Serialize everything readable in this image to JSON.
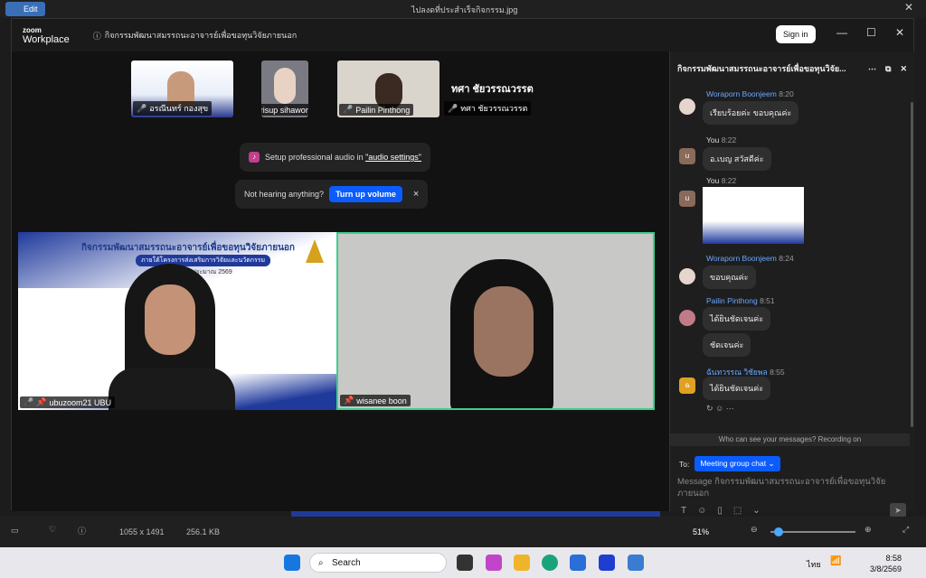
{
  "photos": {
    "edit": "Edit",
    "filename": "ไปลงดที่ประสำเร็จกิจกรรม.jpg"
  },
  "zoom": {
    "logo_top": "zoom",
    "logo_bottom": "Workplace",
    "meeting_title": "กิจกรรมพัฒนาสมรรถนะอาจารย์เพื่อขอทุนวิจัยภายนอก",
    "sign_in": "Sign in"
  },
  "thumbs": [
    {
      "name": "อรณีนทร์ กองสุข"
    },
    {
      "name": "sirisup sihawong"
    },
    {
      "name": "Pailin Pinthong"
    },
    {
      "name": "ทศา ชัยวรรณวรรต"
    }
  ],
  "thumb_caption": "ทศา ชัยวรรณวรรต",
  "audio_popup": {
    "prefix": "Setup professional audio in ",
    "link": "\"audio settings\""
  },
  "hearing_popup": {
    "text": "Not hearing anything?",
    "button": "Turn up volume",
    "close": "×"
  },
  "slide": {
    "title": "กิจกรรมพัฒนาสมรรถนะอาจารย์เพื่อขอทุนวิจัยภายนอก",
    "subtitle": "ภายใต้โครงการส่งเสริมการวิจัยและนวัตกรรม",
    "date": "ประจำปีงบประมาณ 2569"
  },
  "tiles": [
    {
      "name": "ubuzoom21 UBU"
    },
    {
      "name": "wisanee boon"
    }
  ],
  "chat": {
    "title": "กิจกรรมพัฒนาสมรรถนะอาจารย์เพื่อขอทุนวิจัย...",
    "messages": [
      {
        "sender": "Woraporn Boonjeem",
        "time": "8:20",
        "text": "เรียบร้อยค่ะ ขอบคุณค่ะ"
      },
      {
        "sender": "You",
        "time": "8:22",
        "text": "อ.เบญ สวัสดีค่ะ"
      },
      {
        "sender": "You",
        "time": "8:22",
        "text": ""
      },
      {
        "sender": "Woraporn Boonjeem",
        "time": "8:24",
        "text": "ขอบคุณค่ะ"
      },
      {
        "sender": "Pailin Pinthong",
        "time": "8:51",
        "text": "ได้ยินชัดเจนค่ะ"
      },
      {
        "sender": "",
        "time": "",
        "text": "ชัดเจนค่ะ"
      },
      {
        "sender": "ฉันทวรรณ  วิชัยพล",
        "time": "8:55",
        "text": "ได้ยินชัดเจนค่ะ"
      }
    ],
    "avatar_you": "u",
    "avatar_ch": "ฉ",
    "recording_note": "Who can see your messages? Recording on",
    "to_label": "To:",
    "to_value": "Meeting group chat",
    "placeholder": "Message กิจกรรมพัฒนาสมรรถนะอาจารย์เพื่อขอทุนวิจัยภายนอก"
  },
  "viewer": {
    "dimensions": "1055 x 1491",
    "filesize": "256.1 KB",
    "zoom": "51%"
  },
  "taskbar": {
    "search": "Search",
    "lang": "ไทย",
    "time": "8:58",
    "date": "3/8/2569"
  },
  "colors": {
    "accent": "#0b5cff",
    "speaker": "#3ccf8e",
    "link": "#6aa7ff"
  }
}
